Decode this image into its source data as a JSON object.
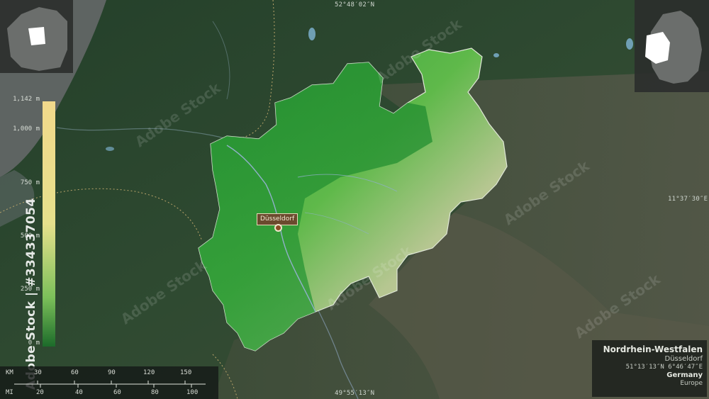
{
  "map": {
    "coord_top": "52°48′02″N",
    "coord_bottom": "49°55′13″N",
    "coord_right": "11°37′30″E"
  },
  "legend": {
    "ticks": [
      "1,142 m",
      "1,000 m",
      "750 m",
      "500 m",
      "250 m",
      "0 m"
    ],
    "colors": {
      "high": "#f1d98a",
      "mid": "#e2e08a",
      "low": "#1f7a2e"
    }
  },
  "city": {
    "name": "Düsseldorf"
  },
  "info": {
    "region": "Nordrhein-Westfalen",
    "capital": "Düsseldorf",
    "coordinates": "51°13′13″N 6°46′47″E",
    "country": "Germany",
    "continent": "Europe"
  },
  "scale": {
    "km_unit": "KM",
    "km_ticks": [
      "30",
      "60",
      "90",
      "120",
      "150"
    ],
    "mi_unit": "MI",
    "mi_ticks": [
      "20",
      "40",
      "60",
      "80",
      "100"
    ]
  },
  "watermark": {
    "stock_id": "Adobe Stock | #334337054",
    "repeat_text": "Adobe Stock"
  }
}
